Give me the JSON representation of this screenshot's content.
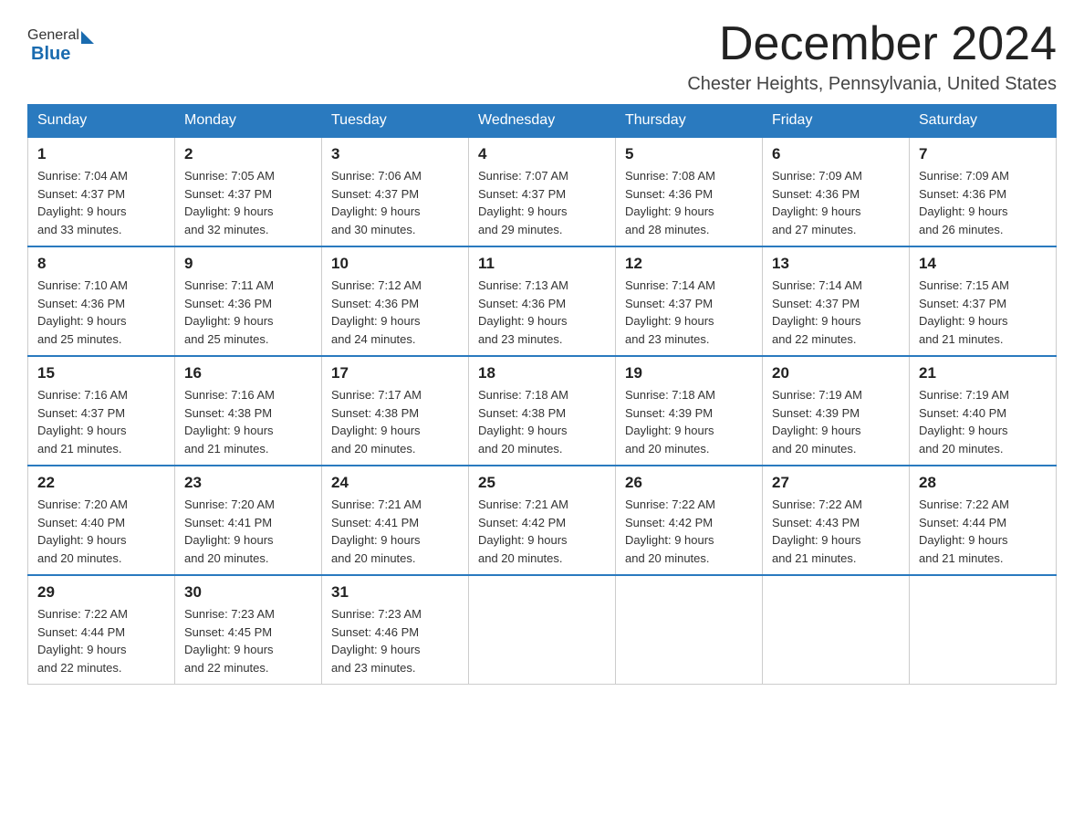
{
  "header": {
    "logo_general": "General",
    "logo_blue": "Blue",
    "month_title": "December 2024",
    "location": "Chester Heights, Pennsylvania, United States"
  },
  "weekdays": [
    "Sunday",
    "Monday",
    "Tuesday",
    "Wednesday",
    "Thursday",
    "Friday",
    "Saturday"
  ],
  "weeks": [
    [
      {
        "day": "1",
        "sunrise": "7:04 AM",
        "sunset": "4:37 PM",
        "daylight": "9 hours and 33 minutes."
      },
      {
        "day": "2",
        "sunrise": "7:05 AM",
        "sunset": "4:37 PM",
        "daylight": "9 hours and 32 minutes."
      },
      {
        "day": "3",
        "sunrise": "7:06 AM",
        "sunset": "4:37 PM",
        "daylight": "9 hours and 30 minutes."
      },
      {
        "day": "4",
        "sunrise": "7:07 AM",
        "sunset": "4:37 PM",
        "daylight": "9 hours and 29 minutes."
      },
      {
        "day": "5",
        "sunrise": "7:08 AM",
        "sunset": "4:36 PM",
        "daylight": "9 hours and 28 minutes."
      },
      {
        "day": "6",
        "sunrise": "7:09 AM",
        "sunset": "4:36 PM",
        "daylight": "9 hours and 27 minutes."
      },
      {
        "day": "7",
        "sunrise": "7:09 AM",
        "sunset": "4:36 PM",
        "daylight": "9 hours and 26 minutes."
      }
    ],
    [
      {
        "day": "8",
        "sunrise": "7:10 AM",
        "sunset": "4:36 PM",
        "daylight": "9 hours and 25 minutes."
      },
      {
        "day": "9",
        "sunrise": "7:11 AM",
        "sunset": "4:36 PM",
        "daylight": "9 hours and 25 minutes."
      },
      {
        "day": "10",
        "sunrise": "7:12 AM",
        "sunset": "4:36 PM",
        "daylight": "9 hours and 24 minutes."
      },
      {
        "day": "11",
        "sunrise": "7:13 AM",
        "sunset": "4:36 PM",
        "daylight": "9 hours and 23 minutes."
      },
      {
        "day": "12",
        "sunrise": "7:14 AM",
        "sunset": "4:37 PM",
        "daylight": "9 hours and 23 minutes."
      },
      {
        "day": "13",
        "sunrise": "7:14 AM",
        "sunset": "4:37 PM",
        "daylight": "9 hours and 22 minutes."
      },
      {
        "day": "14",
        "sunrise": "7:15 AM",
        "sunset": "4:37 PM",
        "daylight": "9 hours and 21 minutes."
      }
    ],
    [
      {
        "day": "15",
        "sunrise": "7:16 AM",
        "sunset": "4:37 PM",
        "daylight": "9 hours and 21 minutes."
      },
      {
        "day": "16",
        "sunrise": "7:16 AM",
        "sunset": "4:38 PM",
        "daylight": "9 hours and 21 minutes."
      },
      {
        "day": "17",
        "sunrise": "7:17 AM",
        "sunset": "4:38 PM",
        "daylight": "9 hours and 20 minutes."
      },
      {
        "day": "18",
        "sunrise": "7:18 AM",
        "sunset": "4:38 PM",
        "daylight": "9 hours and 20 minutes."
      },
      {
        "day": "19",
        "sunrise": "7:18 AM",
        "sunset": "4:39 PM",
        "daylight": "9 hours and 20 minutes."
      },
      {
        "day": "20",
        "sunrise": "7:19 AM",
        "sunset": "4:39 PM",
        "daylight": "9 hours and 20 minutes."
      },
      {
        "day": "21",
        "sunrise": "7:19 AM",
        "sunset": "4:40 PM",
        "daylight": "9 hours and 20 minutes."
      }
    ],
    [
      {
        "day": "22",
        "sunrise": "7:20 AM",
        "sunset": "4:40 PM",
        "daylight": "9 hours and 20 minutes."
      },
      {
        "day": "23",
        "sunrise": "7:20 AM",
        "sunset": "4:41 PM",
        "daylight": "9 hours and 20 minutes."
      },
      {
        "day": "24",
        "sunrise": "7:21 AM",
        "sunset": "4:41 PM",
        "daylight": "9 hours and 20 minutes."
      },
      {
        "day": "25",
        "sunrise": "7:21 AM",
        "sunset": "4:42 PM",
        "daylight": "9 hours and 20 minutes."
      },
      {
        "day": "26",
        "sunrise": "7:22 AM",
        "sunset": "4:42 PM",
        "daylight": "9 hours and 20 minutes."
      },
      {
        "day": "27",
        "sunrise": "7:22 AM",
        "sunset": "4:43 PM",
        "daylight": "9 hours and 21 minutes."
      },
      {
        "day": "28",
        "sunrise": "7:22 AM",
        "sunset": "4:44 PM",
        "daylight": "9 hours and 21 minutes."
      }
    ],
    [
      {
        "day": "29",
        "sunrise": "7:22 AM",
        "sunset": "4:44 PM",
        "daylight": "9 hours and 22 minutes."
      },
      {
        "day": "30",
        "sunrise": "7:23 AM",
        "sunset": "4:45 PM",
        "daylight": "9 hours and 22 minutes."
      },
      {
        "day": "31",
        "sunrise": "7:23 AM",
        "sunset": "4:46 PM",
        "daylight": "9 hours and 23 minutes."
      },
      null,
      null,
      null,
      null
    ]
  ]
}
